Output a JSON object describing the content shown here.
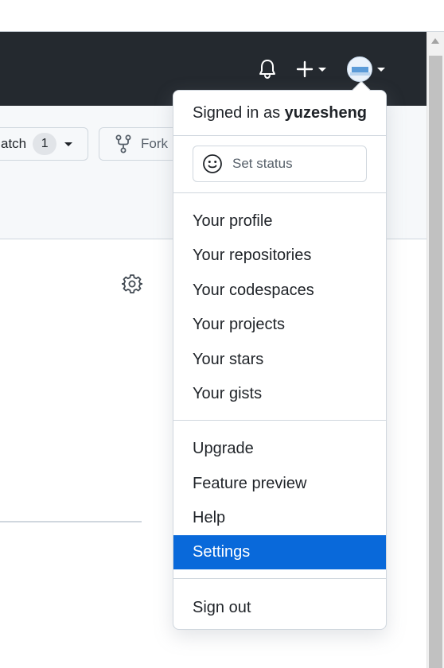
{
  "repo_bar": {
    "watch_label": "atch",
    "watch_count": "1",
    "fork_label": "Fork"
  },
  "dropdown": {
    "signed_in_prefix": "Signed in as ",
    "username": "yuzesheng",
    "set_status": "Set status",
    "items": [
      {
        "label": "Your profile"
      },
      {
        "label": "Your repositories"
      },
      {
        "label": "Your codespaces"
      },
      {
        "label": "Your projects"
      },
      {
        "label": "Your stars"
      },
      {
        "label": "Your gists"
      },
      {
        "label": "Upgrade"
      },
      {
        "label": "Feature preview"
      },
      {
        "label": "Help"
      },
      {
        "label": "Settings"
      },
      {
        "label": "Sign out"
      }
    ],
    "active_item": "Settings"
  },
  "colors": {
    "header_bg": "#24292f",
    "accent": "#0969da",
    "repo_bar_bg": "#f6f8fa",
    "border": "#d0d7de"
  },
  "icons": [
    "bell-icon",
    "plus-icon",
    "avatar",
    "chevron-down-icon",
    "fork-icon",
    "gear-icon",
    "smiley-icon"
  ]
}
